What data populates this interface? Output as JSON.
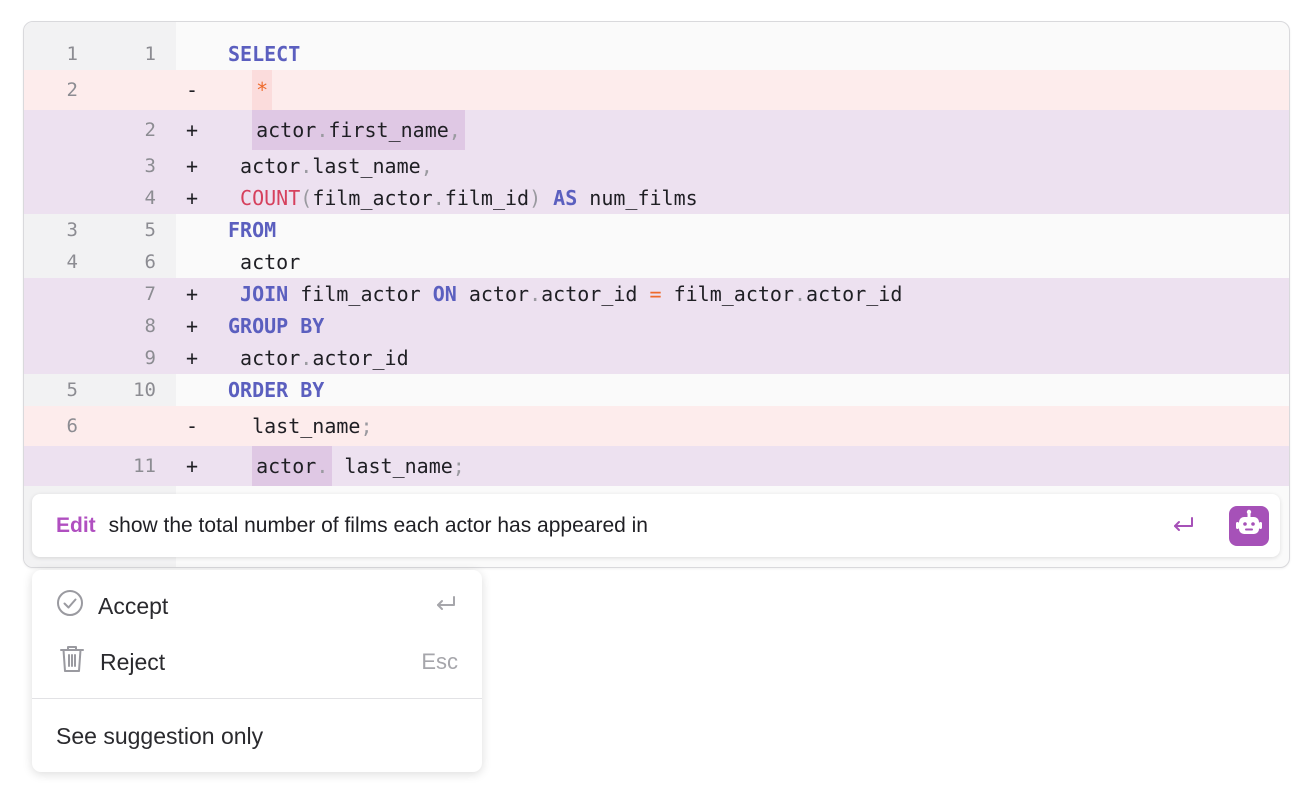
{
  "diff_lines": [
    {
      "type": "ctx",
      "old": "1",
      "new": "1",
      "marker": "",
      "indent": "",
      "tokens": [
        {
          "t": "SELECT",
          "c": "kw"
        }
      ]
    },
    {
      "type": "del",
      "old": "2",
      "new": "",
      "marker": "-",
      "indent": "  ",
      "tokens": [
        {
          "t": "*",
          "c": "op",
          "hl": "red"
        }
      ]
    },
    {
      "type": "add",
      "old": "",
      "new": "2",
      "marker": "+",
      "indent": "  ",
      "tokens": [
        {
          "t": "actor",
          "c": "",
          "hl": "purple"
        },
        {
          "t": ".",
          "c": "punc",
          "hl": "purple"
        },
        {
          "t": "first_name",
          "c": "",
          "hl": "purple"
        },
        {
          "t": ",",
          "c": "punc",
          "hl": "purple"
        }
      ]
    },
    {
      "type": "add",
      "old": "",
      "new": "3",
      "marker": "+",
      "indent": " ",
      "tokens": [
        {
          "t": "actor",
          "c": ""
        },
        {
          "t": ".",
          "c": "punc"
        },
        {
          "t": "last_name",
          "c": ""
        },
        {
          "t": ",",
          "c": "punc"
        }
      ]
    },
    {
      "type": "add",
      "old": "",
      "new": "4",
      "marker": "+",
      "indent": " ",
      "tokens": [
        {
          "t": "COUNT",
          "c": "fn"
        },
        {
          "t": "(",
          "c": "punc"
        },
        {
          "t": "film_actor",
          "c": ""
        },
        {
          "t": ".",
          "c": "punc"
        },
        {
          "t": "film_id",
          "c": ""
        },
        {
          "t": ")",
          "c": "punc"
        },
        {
          "t": " ",
          "c": ""
        },
        {
          "t": "AS",
          "c": "kw"
        },
        {
          "t": " num_films",
          "c": ""
        }
      ]
    },
    {
      "type": "ctx",
      "old": "3",
      "new": "5",
      "marker": "",
      "indent": "",
      "tokens": [
        {
          "t": "FROM",
          "c": "kw"
        }
      ]
    },
    {
      "type": "ctx",
      "old": "4",
      "new": "6",
      "marker": "",
      "indent": " ",
      "tokens": [
        {
          "t": "actor",
          "c": ""
        }
      ]
    },
    {
      "type": "add",
      "old": "",
      "new": "7",
      "marker": "+",
      "indent": " ",
      "tokens": [
        {
          "t": "JOIN",
          "c": "kw"
        },
        {
          "t": " film_actor ",
          "c": ""
        },
        {
          "t": "ON",
          "c": "kw"
        },
        {
          "t": " actor",
          "c": ""
        },
        {
          "t": ".",
          "c": "punc"
        },
        {
          "t": "actor_id ",
          "c": ""
        },
        {
          "t": "=",
          "c": "op"
        },
        {
          "t": " film_actor",
          "c": ""
        },
        {
          "t": ".",
          "c": "punc"
        },
        {
          "t": "actor_id",
          "c": ""
        }
      ]
    },
    {
      "type": "add",
      "old": "",
      "new": "8",
      "marker": "+",
      "indent": "",
      "tokens": [
        {
          "t": "GROUP BY",
          "c": "kw"
        }
      ]
    },
    {
      "type": "add",
      "old": "",
      "new": "9",
      "marker": "+",
      "indent": " ",
      "tokens": [
        {
          "t": "actor",
          "c": ""
        },
        {
          "t": ".",
          "c": "punc"
        },
        {
          "t": "actor_id",
          "c": ""
        }
      ]
    },
    {
      "type": "ctx",
      "old": "5",
      "new": "10",
      "marker": "",
      "indent": "",
      "tokens": [
        {
          "t": "ORDER BY",
          "c": "kw"
        }
      ]
    },
    {
      "type": "del",
      "old": "6",
      "new": "",
      "marker": "-",
      "indent": "  ",
      "tokens": [
        {
          "t": "last_name",
          "c": ""
        },
        {
          "t": ";",
          "c": "punc"
        }
      ]
    },
    {
      "type": "add",
      "old": "",
      "new": "11",
      "marker": "+",
      "indent": "  ",
      "tokens": [
        {
          "t": "actor",
          "c": "",
          "hl": "purple"
        },
        {
          "t": ".",
          "c": "punc",
          "hl": "purple"
        },
        {
          "t": " last_name",
          "c": ""
        },
        {
          "t": ";",
          "c": "punc"
        }
      ]
    }
  ],
  "prompt": {
    "label": "Edit",
    "text": "show the total number of films each actor has appeared in",
    "submit_icon": "enter-icon",
    "assistant_icon": "robot-icon",
    "accent_color": "#a651b8"
  },
  "menu": {
    "accept_label": "Accept",
    "accept_icon": "check-circle-icon",
    "accept_shortcut_icon": "enter-icon",
    "reject_label": "Reject",
    "reject_icon": "trash-icon",
    "reject_shortcut": "Esc",
    "suggestion_label": "See suggestion only"
  },
  "colors": {
    "keyword": "#5b5fbf",
    "function": "#d6405d",
    "operator": "#ee6a2c",
    "added_bg": "#ede1f0",
    "removed_bg": "#fdecec"
  }
}
